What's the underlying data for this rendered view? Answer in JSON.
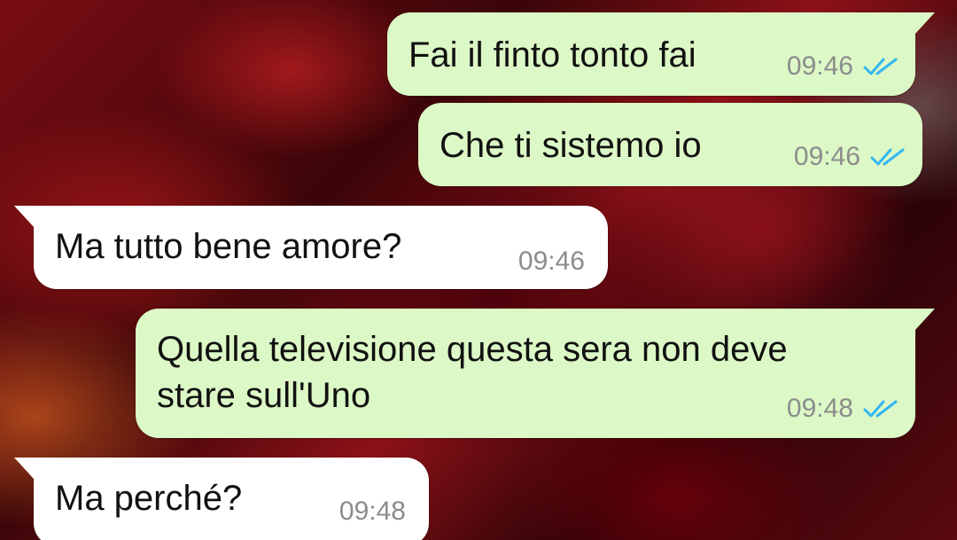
{
  "chat": {
    "messages": [
      {
        "direction": "out",
        "text": "Fai il finto tonto fai",
        "time": "09:46",
        "status": "read",
        "status_icon": "double-check-icon"
      },
      {
        "direction": "out",
        "text": "Che ti sistemo io",
        "time": "09:46",
        "status": "read",
        "status_icon": "double-check-icon"
      },
      {
        "direction": "in",
        "text": "Ma tutto bene amore?",
        "time": "09:46"
      },
      {
        "direction": "out",
        "text_line1": "Quella televisione questa sera non deve",
        "text_line2": "stare sull'Uno",
        "time": "09:48",
        "status": "read",
        "status_icon": "double-check-icon"
      },
      {
        "direction": "in",
        "text": "Ma perché?",
        "time": "09:48"
      }
    ]
  },
  "colors": {
    "outgoing_bubble": "#dcf8c6",
    "incoming_bubble": "#ffffff",
    "read_tick": "#34b7f1",
    "timestamp": "#8c8c8c",
    "wallpaper": "#7a0d14"
  }
}
